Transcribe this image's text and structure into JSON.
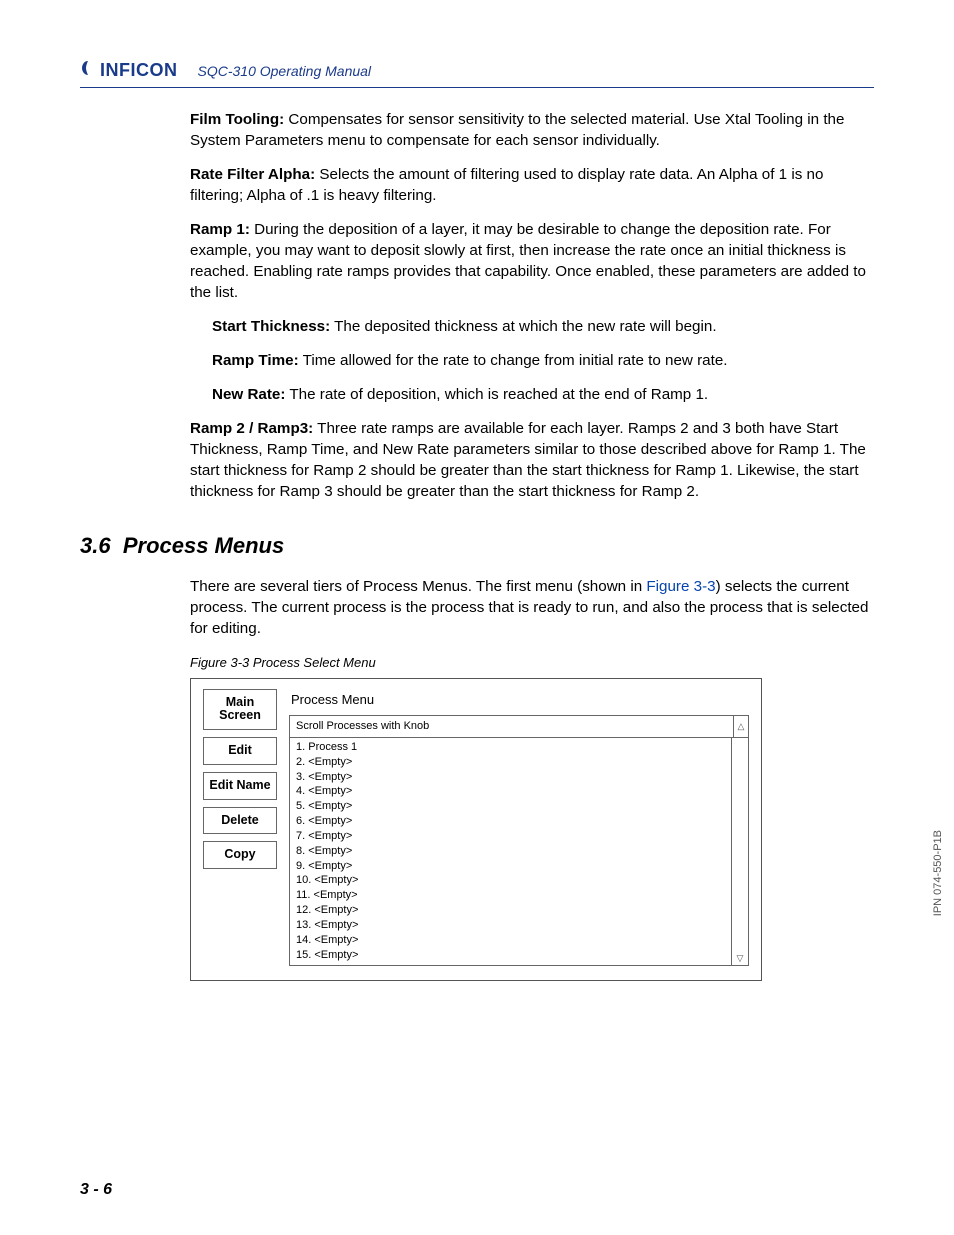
{
  "header": {
    "brand": "INFICON",
    "doc_title": "SQC-310 Operating Manual"
  },
  "body": {
    "para1": {
      "label": "Film Tooling:",
      "text": " Compensates for sensor sensitivity to the selected material. Use Xtal Tooling in the System Parameters menu to compensate for each sensor individually."
    },
    "para2": {
      "label": "Rate Filter Alpha:",
      "text": " Selects the amount of filtering used to display rate data. An Alpha of 1 is no filtering; Alpha of .1 is heavy filtering."
    },
    "para3": {
      "label": "Ramp 1:",
      "text": " During the deposition of a layer, it may be desirable to change the deposition rate. For example, you may want to deposit slowly at first, then increase the rate once an initial thickness is reached. Enabling rate ramps provides that capability. Once enabled, these parameters are added to the list."
    },
    "sub1": {
      "label": "Start Thickness:",
      "text": " The deposited thickness at which the new rate will begin."
    },
    "sub2": {
      "label": "Ramp Time:",
      "text": " Time allowed for the rate to change from initial rate to new rate."
    },
    "sub3": {
      "label": "New Rate:",
      "text": " The rate of deposition, which is reached at the end of Ramp 1."
    },
    "para4": {
      "label": "Ramp 2 / Ramp3:",
      "text": " Three rate ramps are available for each layer. Ramps 2 and 3 both have Start Thickness, Ramp Time, and New Rate parameters similar to those described above for Ramp 1. The start thickness for Ramp 2 should be greater than the start thickness for Ramp 1. Likewise, the start thickness for Ramp 3 should be greater than the start thickness for Ramp 2."
    }
  },
  "section": {
    "number": "3.6",
    "title": "Process Menus"
  },
  "section_intro": {
    "pre": "There are several tiers of Process Menus. The first menu (shown in ",
    "xref": "Figure 3-3",
    "post": ") selects the current process. The current process is the process that is ready to run, and also the process that is selected for editing."
  },
  "figure": {
    "caption": "Figure 3-3  Process Select Menu",
    "softkeys": [
      "Main Screen",
      "Edit",
      "Edit Name",
      "Delete",
      "Copy"
    ],
    "menu_title": "Process Menu",
    "instruction": "Scroll Processes with Knob",
    "items": [
      "1. Process 1",
      "2. <Empty>",
      "3. <Empty>",
      "4. <Empty>",
      "5. <Empty>",
      "6. <Empty>",
      "7. <Empty>",
      "8. <Empty>",
      "9. <Empty>",
      "10. <Empty>",
      "11. <Empty>",
      "12. <Empty>",
      "13. <Empty>",
      "14. <Empty>",
      "15. <Empty>"
    ]
  },
  "side_ipn": "IPN 074-550-P1B",
  "footer_page": "3 - 6"
}
